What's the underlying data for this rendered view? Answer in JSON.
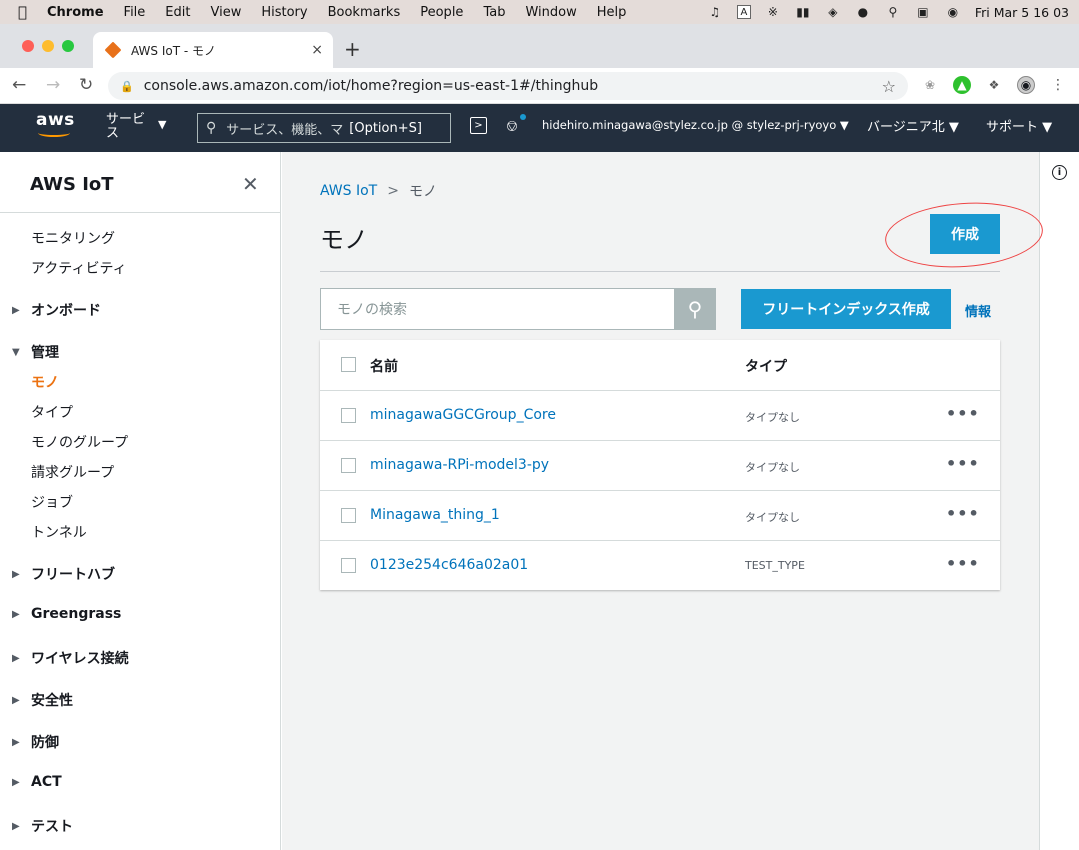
{
  "menubar": {
    "apple": "",
    "app": "Chrome",
    "items": [
      "File",
      "Edit",
      "View",
      "History",
      "Bookmarks",
      "People",
      "Tab",
      "Window",
      "Help"
    ],
    "clock": "Fri Mar 5  16 03",
    "input_source": "A"
  },
  "tab": {
    "title": "AWS IoT - モノ",
    "new_tab": "+",
    "close": "×"
  },
  "address": {
    "url": "console.aws.amazon.com/iot/home?region=us-east-1#/thinghub"
  },
  "aws": {
    "logo": "aws",
    "services": "サービス",
    "search_placeholder": "サービス、機能、マ",
    "search_shortcut": "[Option+S]",
    "user": "hidehiro.minagawa@stylez.co.jp @ stylez-prj-ryoyo ▼",
    "region": "バージニア北  ▼",
    "support": "サポート  ▼"
  },
  "sidebar": {
    "title": "AWS IoT",
    "top_items": [
      "モニタリング",
      "アクティビティ"
    ],
    "onboard": "オンボード",
    "manage": "管理",
    "manage_items": [
      "モノ",
      "タイプ",
      "モノのグループ",
      "請求グループ",
      "ジョブ",
      "トンネル"
    ],
    "sections": [
      "フリートハブ",
      "Greengrass",
      "ワイヤレス接続",
      "安全性",
      "防御",
      "ACT",
      "テスト"
    ]
  },
  "main": {
    "breadcrumb_root": "AWS IoT",
    "breadcrumb_sep": ">",
    "breadcrumb_current": "モノ",
    "title": "モノ",
    "create_button": "作成",
    "search_placeholder": "モノの検索",
    "fleet_button": "フリートインデックス作成",
    "info_link": "情報",
    "columns": {
      "name": "名前",
      "type": "タイプ"
    },
    "rows": [
      {
        "name": "minagawaGGCGroup_Core",
        "type": "タイプなし"
      },
      {
        "name": "minagawa-RPi-model3-py",
        "type": "タイプなし"
      },
      {
        "name": "Minagawa_thing_1",
        "type": "タイプなし"
      },
      {
        "name": "0123e254c646a02a01",
        "type": "TEST_TYPE"
      }
    ],
    "more": "•••"
  },
  "colors": {
    "aws_header": "#232f3e",
    "accent": "#1a99d0",
    "link": "#0073bb",
    "active": "#ec7211",
    "annotation": "#e44444"
  }
}
